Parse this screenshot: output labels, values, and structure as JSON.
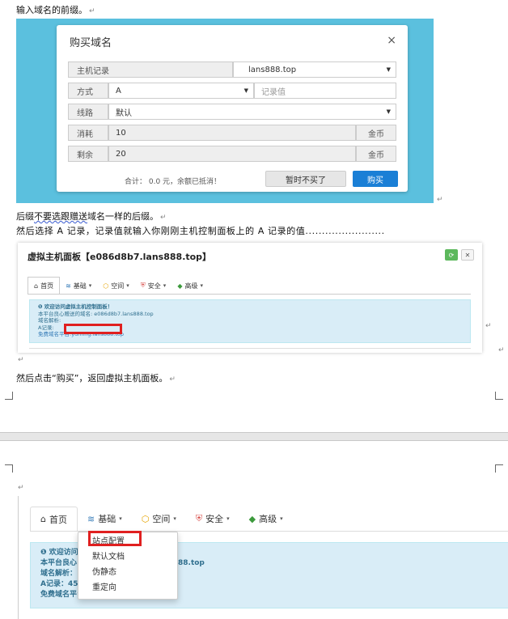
{
  "doc": {
    "line1": "输入域名的前缀。",
    "line2_a": "后缀",
    "line2_b": "不要选跟赠送",
    "line2_c": "域名一样的后缀。",
    "line3": "然后选择 A 记录，记录值就输入你刚刚主机控制面板上的 A 记录的值........................",
    "line4": "然后点击“购买”，返回虚拟主机面板。",
    "para_mark": "↵"
  },
  "buy_dialog": {
    "title": "购买域名",
    "close": "×",
    "host_label": "主机记录",
    "domain_value": "lans888.top",
    "mode_label": "方式",
    "mode_value": "A",
    "record_placeholder": "记录值",
    "line_label": "线路",
    "line_value": "默认",
    "cost_label": "消耗",
    "cost_value": "10",
    "cost_unit": "金币",
    "remain_label": "剩余",
    "remain_value": "20",
    "remain_unit": "金币",
    "footer_text": "合计： 0.0 元，余额已抵消！",
    "cancel_button": "暂时不买了",
    "buy_button": "购买"
  },
  "panel": {
    "title": "虚拟主机面板【e086d8b7.lans888.top】",
    "tabs": [
      "首页",
      "基础",
      "空间",
      "安全",
      "高级"
    ],
    "info_lines": [
      "❶ 欢迎访问虚拟主机控制面板！",
      "本平台良心赠送的域名: e086d8b7.lans888.top",
      "域名解析:",
      "A记录:",
      "免费域名平台:yuming.lans888.top"
    ]
  },
  "panel2": {
    "tabs": [
      "首页",
      "基础",
      "空间",
      "安全",
      "高级"
    ],
    "info_lines": [
      "❶ 欢迎访问",
      "本平台良心",
      "域名解析：",
      "A记录：45.",
      "免费域名平台"
    ],
    "domain_fragment": "88.top",
    "dropdown": [
      "站点配置",
      "默认文档",
      "伪静态",
      "重定向"
    ]
  },
  "colors": {
    "cyan_bg": "#5bc0de",
    "blue_button": "#1a7fd6",
    "info_bg": "#d9edf7",
    "red_highlight": "#e02020"
  }
}
